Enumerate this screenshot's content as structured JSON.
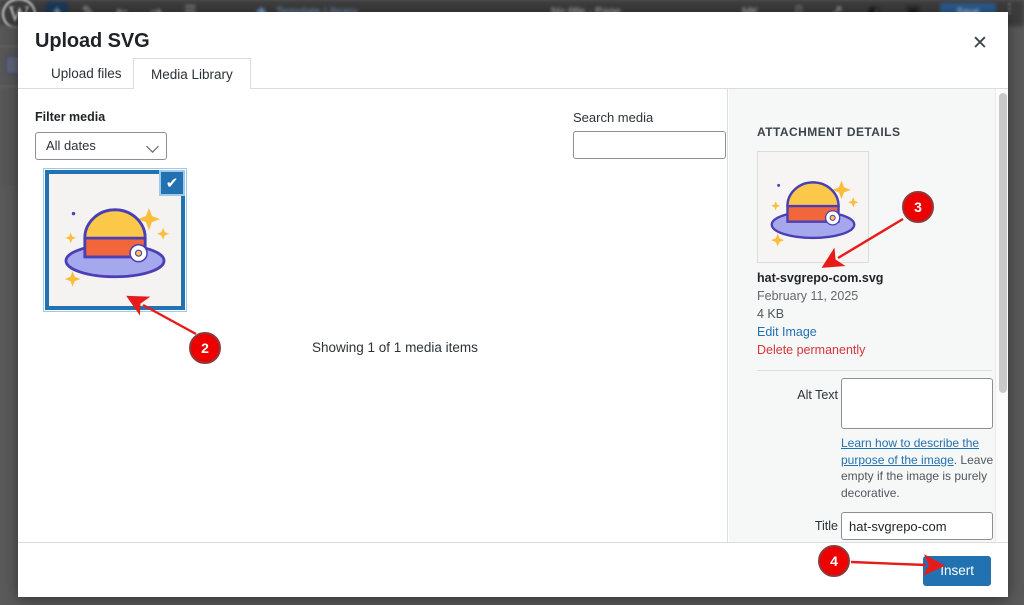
{
  "background": {
    "wp_logo_glyph": "W",
    "plus_glyph": "+",
    "toolbar_icons": [
      "pencil-icon",
      "undo-arrow-icon",
      "redo-arrow-icon",
      "list-view-icon"
    ],
    "template_library_label": "Template Library",
    "doc_title_label": "No title - Page",
    "zoom_label": "MK",
    "save_label": "Save",
    "kebab_glyph": "⋮"
  },
  "modal": {
    "title": "Upload SVG",
    "close_glyph": "✕",
    "tabs": [
      {
        "label": "Upload files",
        "active": false
      },
      {
        "label": "Media Library",
        "active": true
      }
    ]
  },
  "library": {
    "filter_label": "Filter media",
    "filter_value": "All dates",
    "filter_options": [
      "All dates"
    ],
    "search_label": "Search media",
    "search_value": "",
    "search_placeholder": "",
    "checked_glyph": "✔",
    "showing_text": "Showing 1 of 1 media items",
    "media_item_name": "hat-svgrepo-com.svg"
  },
  "attachment": {
    "panel_heading": "ATTACHMENT DETAILS",
    "filename": "hat-svgrepo-com.svg",
    "date": "February 11, 2025",
    "filesize": "4 KB",
    "edit_link": "Edit Image",
    "delete_link": "Delete permanently",
    "alt_label": "Alt Text",
    "alt_value": "",
    "alt_placeholder": "",
    "help_link": "Learn how to describe the purpose of the image",
    "help_rest": ". Leave empty if the image is purely decorative.",
    "title_label": "Title",
    "title_value": "hat-svgrepo-com"
  },
  "footer": {
    "insert_label": "Insert"
  },
  "annotations": [
    {
      "id": "2",
      "label": "2"
    },
    {
      "id": "3",
      "label": "3"
    },
    {
      "id": "4",
      "label": "4"
    }
  ],
  "colors": {
    "accent_blue": "#2271b1",
    "annotation_red": "#ee0000",
    "delete_red": "#d63638",
    "panel_bg": "#f6f7f7"
  }
}
